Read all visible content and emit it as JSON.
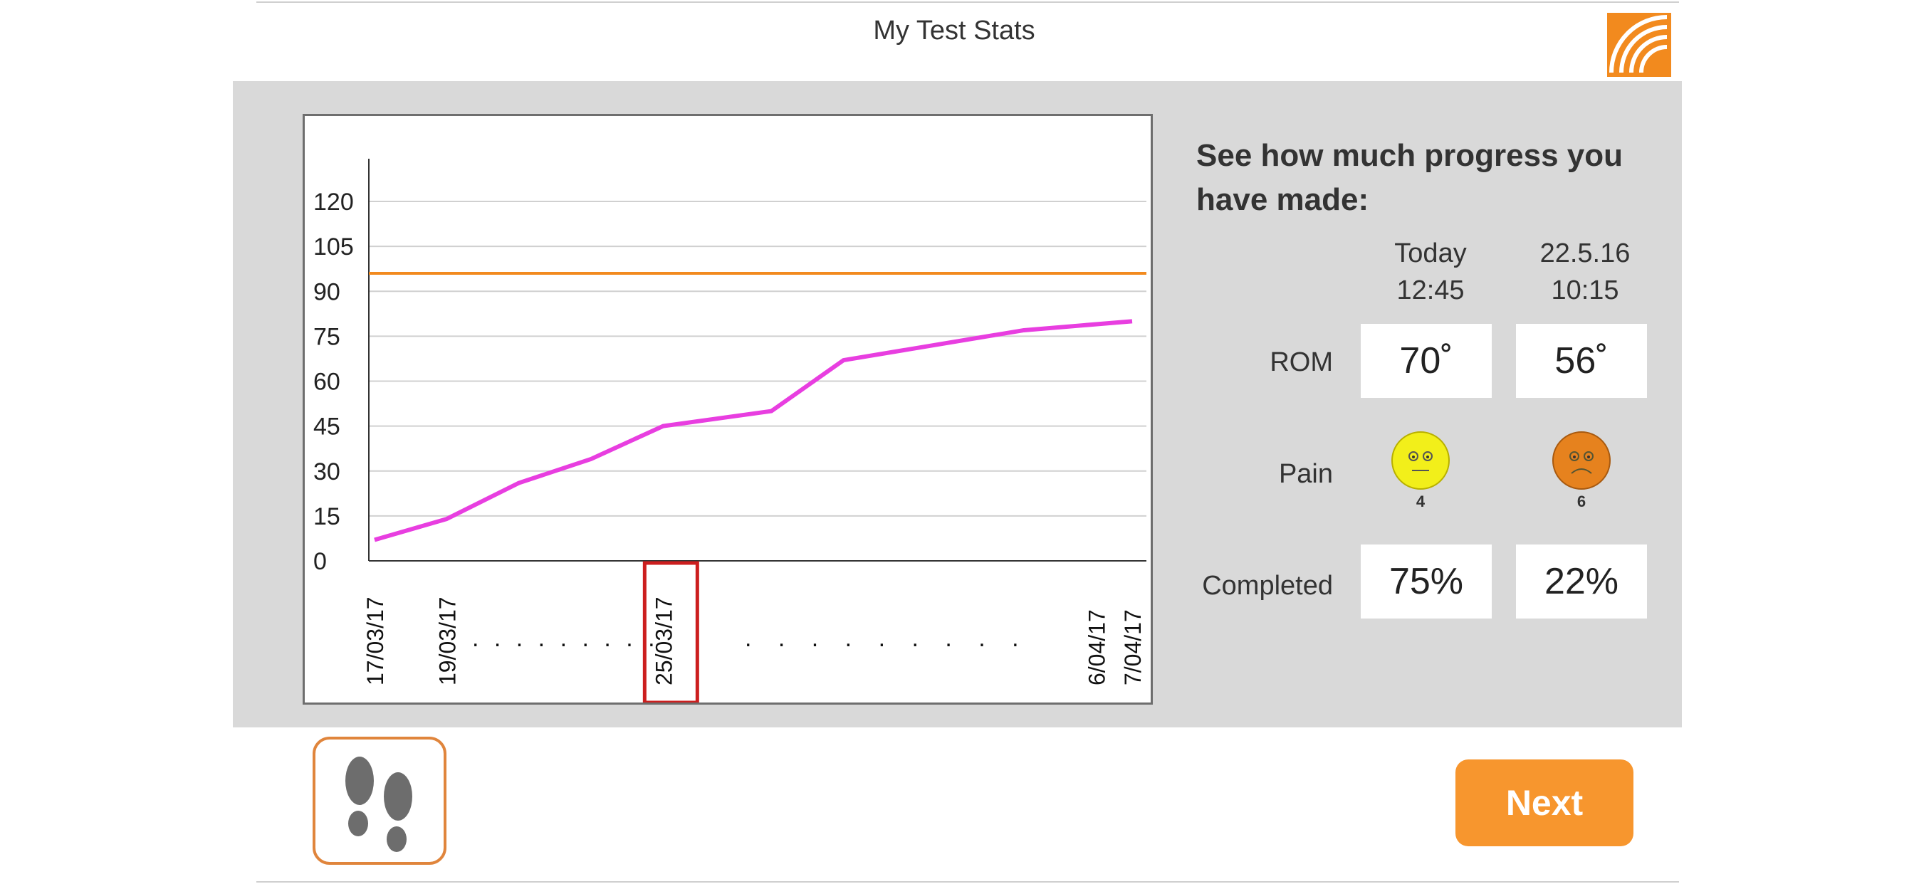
{
  "header": {
    "title": "My Test Stats",
    "logo_icon": "signal-waves-logo"
  },
  "chart_data": {
    "type": "line",
    "y_ticks": [
      "0",
      "15",
      "30",
      "45",
      "60",
      "75",
      "90",
      "105",
      "120"
    ],
    "ylim": [
      0,
      120
    ],
    "grid": true,
    "x_labels": [
      "17/03/17",
      "19/03/17",
      "25/03/17",
      "6/04/17",
      "7/04/17"
    ],
    "x_label_dates": [
      "2017-03-17",
      "2017-03-19",
      "2017-03-25",
      "2017-04-06",
      "2017-04-07"
    ],
    "x_ellipsis": ". . . . . . . . .",
    "highlighted_x_label": "25/03/17",
    "series": [
      {
        "color": "#e83ee0",
        "points": [
          [
            "2017-03-17",
            7
          ],
          [
            "2017-03-19",
            14
          ],
          [
            "2017-03-21",
            26
          ],
          [
            "2017-03-23",
            34
          ],
          [
            "2017-03-25",
            45
          ],
          [
            "2017-03-28",
            50
          ],
          [
            "2017-03-30",
            67
          ],
          [
            "2017-04-04",
            77
          ],
          [
            "2017-04-07",
            80
          ]
        ]
      }
    ],
    "reference_line": {
      "value": 96,
      "color": "#f28a1e"
    }
  },
  "progress": {
    "heading": "See how much progress you have made:",
    "columns": [
      {
        "line1": "Today",
        "line2": "12:45"
      },
      {
        "line1": "22.5.16",
        "line2": "10:15"
      }
    ],
    "rom_label": "ROM",
    "rom_values": [
      "70˚",
      "56˚"
    ],
    "pain_label": "Pain",
    "pain_values": [
      "4",
      "6"
    ],
    "pain_colors": [
      "#f2ef1a",
      "#e6821e"
    ],
    "completed_label": "Completed",
    "completed_values": [
      "75%",
      "22%"
    ]
  },
  "buttons": {
    "steps_icon": "footprints-icon",
    "next_label": "Next"
  }
}
